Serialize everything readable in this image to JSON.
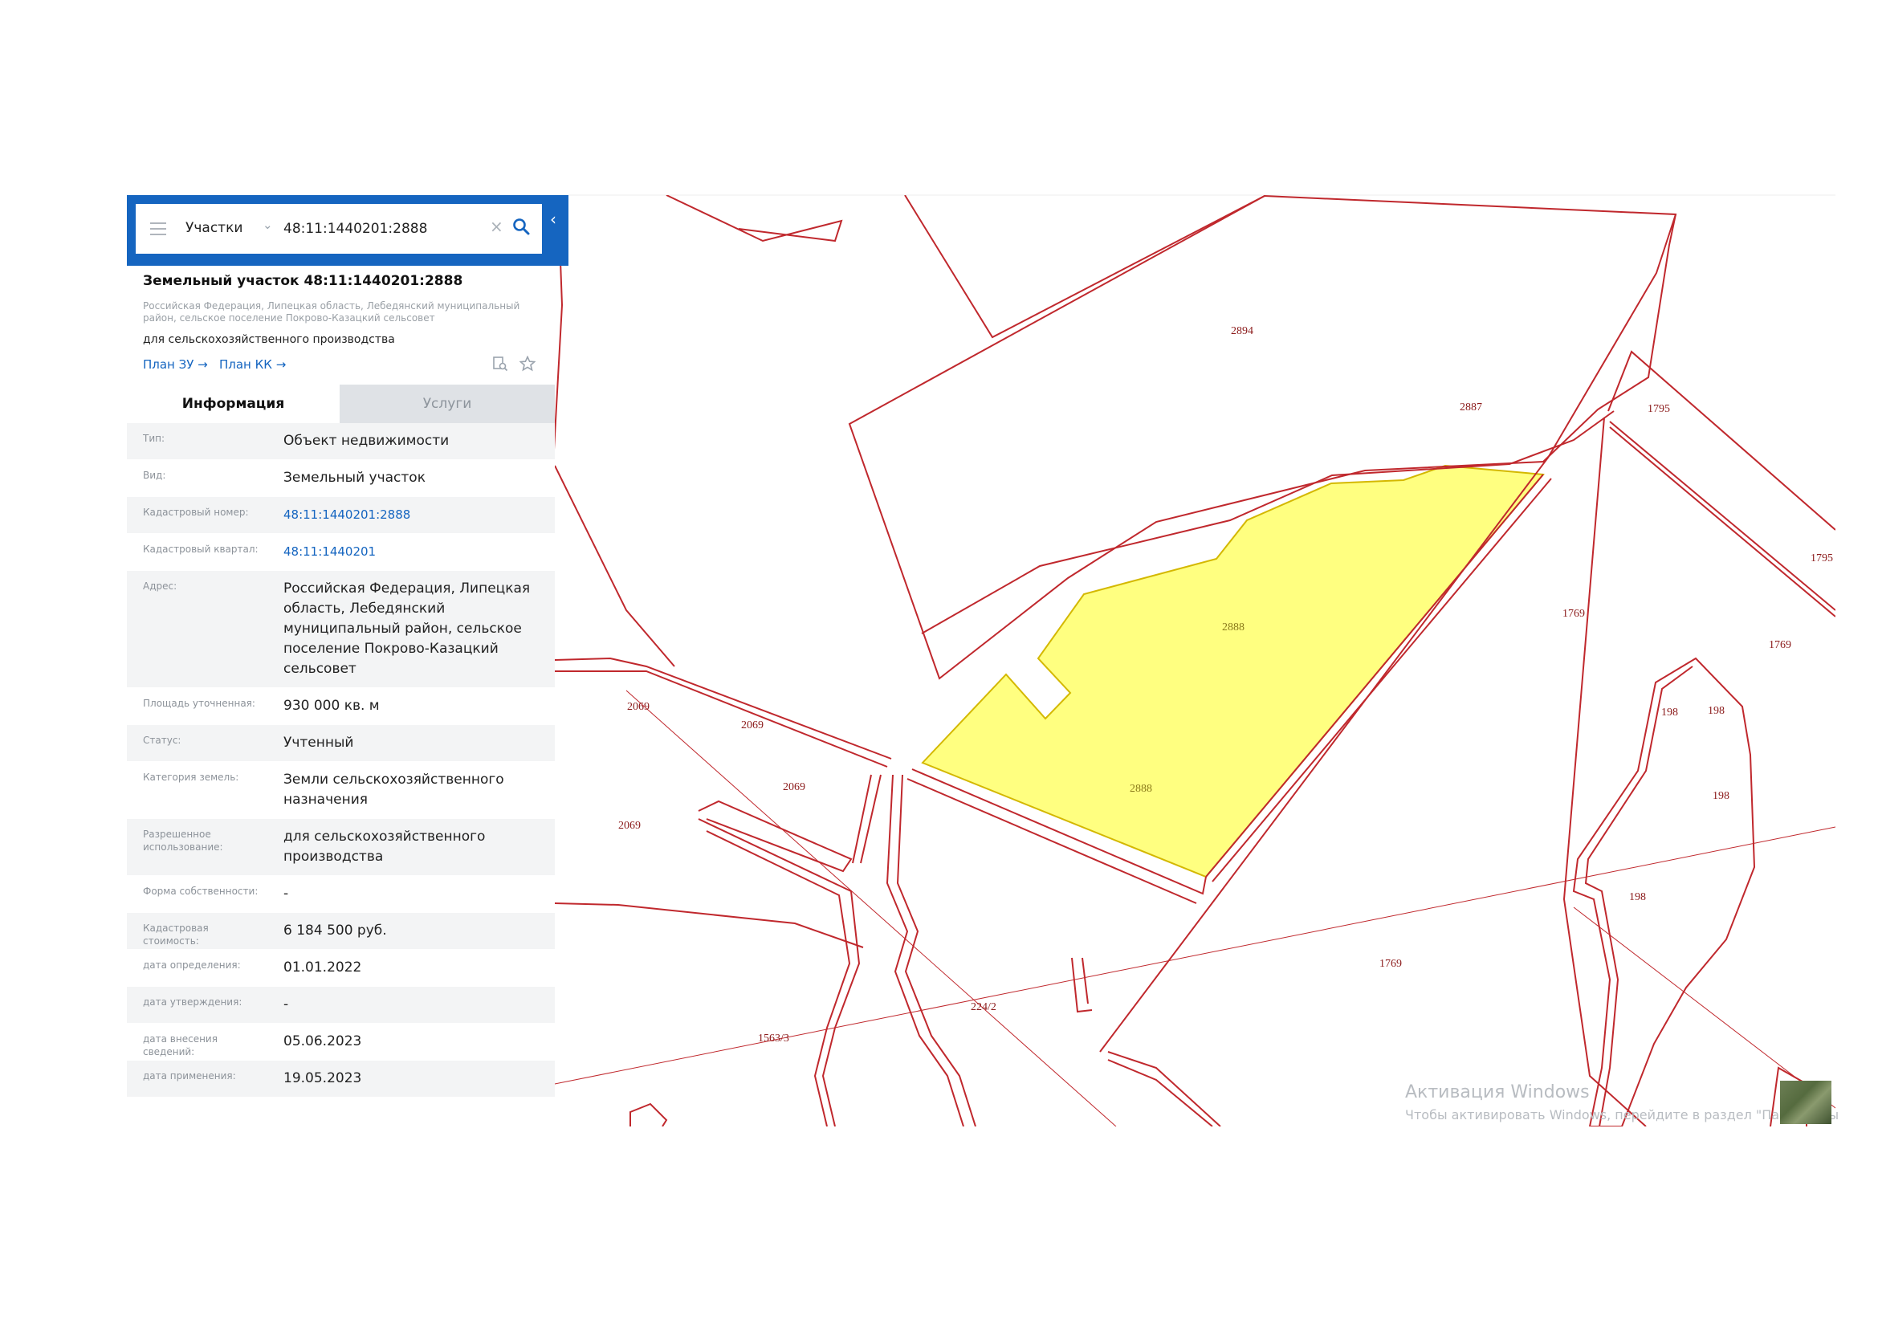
{
  "search": {
    "mode_label": "Участки",
    "query": "48:11:1440201:2888"
  },
  "parcel": {
    "title": "Земельный участок 48:11:1440201:2888",
    "address": "Российская Федерация, Липецкая область, Лебедянский муниципальный район, сельское поселение Покрово-Казацкий сельсовет",
    "purpose": "для сельскохозяйственного производства",
    "plan_zu_label": "План ЗУ →",
    "plan_kk_label": "План КК →"
  },
  "tabs": [
    {
      "label": "Информация",
      "active": true
    },
    {
      "label": "Услуги",
      "active": false
    }
  ],
  "info_rows": [
    {
      "key": "Тип:",
      "value": "Объект недвижимости"
    },
    {
      "key": "Вид:",
      "value": "Земельный участок"
    },
    {
      "key": "Кадастровый номер:",
      "value": "48:11:1440201:2888"
    },
    {
      "key": "Кадастровый квартал:",
      "value": "48:11:1440201"
    },
    {
      "key": "Адрес:",
      "value": "Российская Федерация, Липецкая область, Лебедянский муниципальный район, сельское поселение Покрово-Казацкий сельсовет"
    },
    {
      "key": "Площадь уточненная:",
      "value": "930 000 кв. м"
    },
    {
      "key": "Статус:",
      "value": "Учтенный"
    },
    {
      "key": "Категория земель:",
      "value": "Земли сельскохозяйственного назначения"
    },
    {
      "key": "Разрешенное использование:",
      "value": "для сельскохозяйственного производства"
    },
    {
      "key": "Форма собственности:",
      "value": "-"
    },
    {
      "key": "Кадастровая стоимость:",
      "value": "6 184 500 руб."
    },
    {
      "key": "дата определения:",
      "value": "01.01.2022"
    },
    {
      "key": "дата утверждения:",
      "value": "-"
    },
    {
      "key": "дата внесения сведений:",
      "value": "05.06.2023"
    },
    {
      "key": "дата применения:",
      "value": "19.05.2023"
    }
  ],
  "map": {
    "selected_fill": "#ffff80",
    "boundary_color": "#c0282d",
    "labels": {
      "l2894": "2894",
      "l2887": "2887",
      "l1795a": "1795",
      "l1795b": "1795",
      "l2888a": "2888",
      "l2888b": "2888",
      "l1769a": "1769",
      "l1769b": "1769",
      "l1769c": "1769",
      "l2069a": "2069",
      "l2069b": "2069",
      "l2069c": "2069",
      "l2069d": "2069",
      "l198a": "198",
      "l198b": "198",
      "l198c": "198",
      "l198d": "198",
      "l2242": "224/2",
      "l15633": "1563/3"
    }
  },
  "watermark": {
    "title": "Активация Windows",
    "subtitle": "Чтобы активировать Windows, перейдите в раздел \"Параметры"
  }
}
